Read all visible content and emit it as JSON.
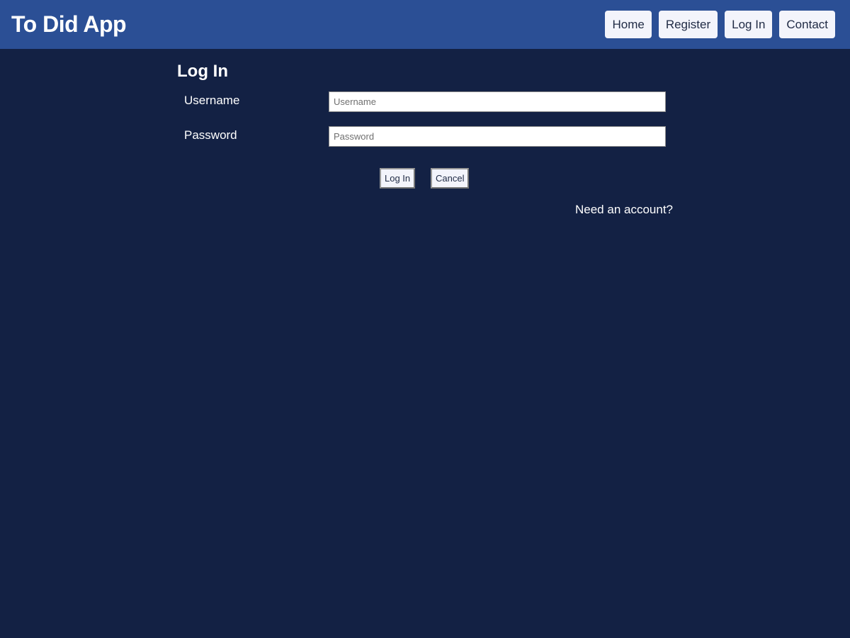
{
  "app": {
    "title": "To Did App"
  },
  "nav": {
    "items": [
      {
        "label": "Home"
      },
      {
        "label": "Register"
      },
      {
        "label": "Log In"
      },
      {
        "label": "Contact"
      }
    ]
  },
  "login": {
    "heading": "Log In",
    "username": {
      "label": "Username",
      "placeholder": "Username",
      "value": ""
    },
    "password": {
      "label": "Password",
      "placeholder": "Password",
      "value": ""
    },
    "submit_label": "Log In",
    "cancel_label": "Cancel",
    "register_link": "Need an account?"
  },
  "colors": {
    "page_background": "#132144",
    "header_background": "#2b4f95",
    "button_background": "#f3f4fb",
    "text": "#ffffff"
  }
}
